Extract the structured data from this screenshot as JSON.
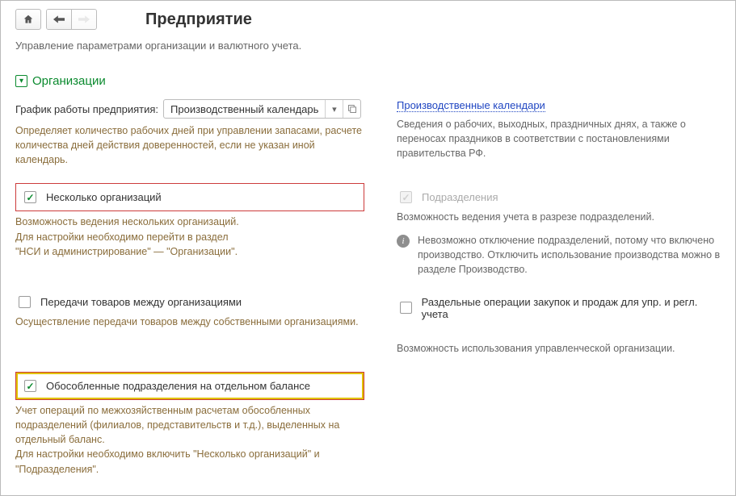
{
  "header": {
    "title": "Предприятие",
    "subtitle": "Управление параметрами организации и валютного учета."
  },
  "section": {
    "title": "Организации"
  },
  "schedule": {
    "label": "График работы предприятия:",
    "value": "Производственный календарь",
    "link": "Производственные календари",
    "hint_left": "Определяет количество рабочих дней при управлении запасами, расчете количества дней действия доверенностей, если не указан иной календарь.",
    "hint_right": "Сведения о рабочих, выходных, праздничных днях, а также о переносах праздников в соответствии с постановлениями правительства РФ."
  },
  "multi_org": {
    "label": "Несколько организаций",
    "hint": "Возможность ведения нескольких организаций.\nДля настройки необходимо перейти в раздел\n\"НСИ и администрирование\" — \"Организации\"."
  },
  "divisions": {
    "label": "Подразделения",
    "hint": "Возможность ведения учета в разрезе подразделений.",
    "info": "Невозможно отключение подразделений, потому что включено производство. Отключить использование производства можно в разделе Производство."
  },
  "transfers": {
    "label": "Передачи товаров между организациями",
    "hint": "Осуществление передачи товаров между собственными организациями."
  },
  "split_ops": {
    "label": "Раздельные операции закупок и продаж для упр. и регл. учета",
    "hint": "Возможность использования управленческой организации."
  },
  "standalone": {
    "label": "Обособленные подразделения на отдельном балансе",
    "hint": "Учет операций по межхозяйственным расчетам обособленных подразделений (филиалов, представительств и т.д.), выделенных на отдельный баланс.\nДля настройки необходимо включить \"Несколько организаций\" и \"Подразделения\"."
  }
}
